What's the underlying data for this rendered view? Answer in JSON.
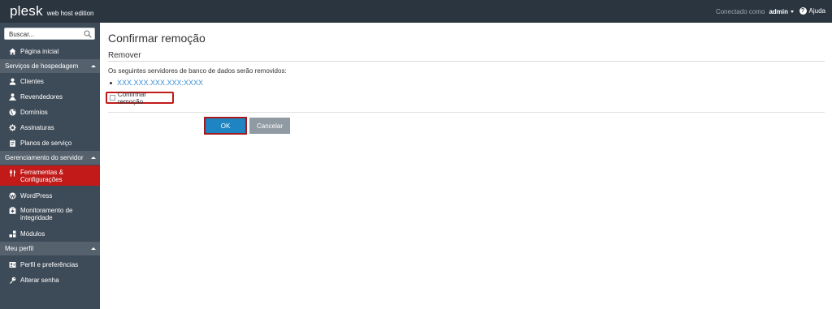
{
  "header": {
    "logo_main": "plesk",
    "logo_sub": "web host edition",
    "connected_label": "Conectado como",
    "user": "admin",
    "help_label": "Ajuda"
  },
  "sidebar": {
    "search_placeholder": "Buscar...",
    "home": "Página inicial",
    "sections": [
      {
        "title": "Serviços de hospedagem",
        "items": [
          "Clientes",
          "Revendedores",
          "Domínios",
          "Assinaturas",
          "Planos de serviço"
        ]
      },
      {
        "title": "Gerenciamento do servidor",
        "items": [
          {
            "line1": "Ferramentas &",
            "line2": "Configurações",
            "active": true
          },
          {
            "line1": "WordPress"
          },
          {
            "line1": "Monitoramento de",
            "line2": "integridade"
          },
          {
            "line1": "Módulos"
          }
        ]
      },
      {
        "title": "Meu perfil",
        "items": [
          "Perfil e preferências",
          "Alterar senha"
        ]
      }
    ]
  },
  "main": {
    "title": "Confirmar remoção",
    "section": "Remover",
    "description": "Os seguintes servidores de banco de dados serão removidos:",
    "servers": [
      "XXX.XXX.XXX.XXX:XXXX"
    ],
    "confirm_label": "Confirmar remoção",
    "ok_label": "OK",
    "cancel_label": "Cancelar"
  },
  "colors": {
    "topbar": "#2b3540",
    "sidebar": "#3d4a57",
    "section_header": "#55616d",
    "active_item": "#c21919",
    "link": "#3d8fd6",
    "ok_button": "#1f85c2",
    "cancel_button": "#8f9aa3"
  }
}
